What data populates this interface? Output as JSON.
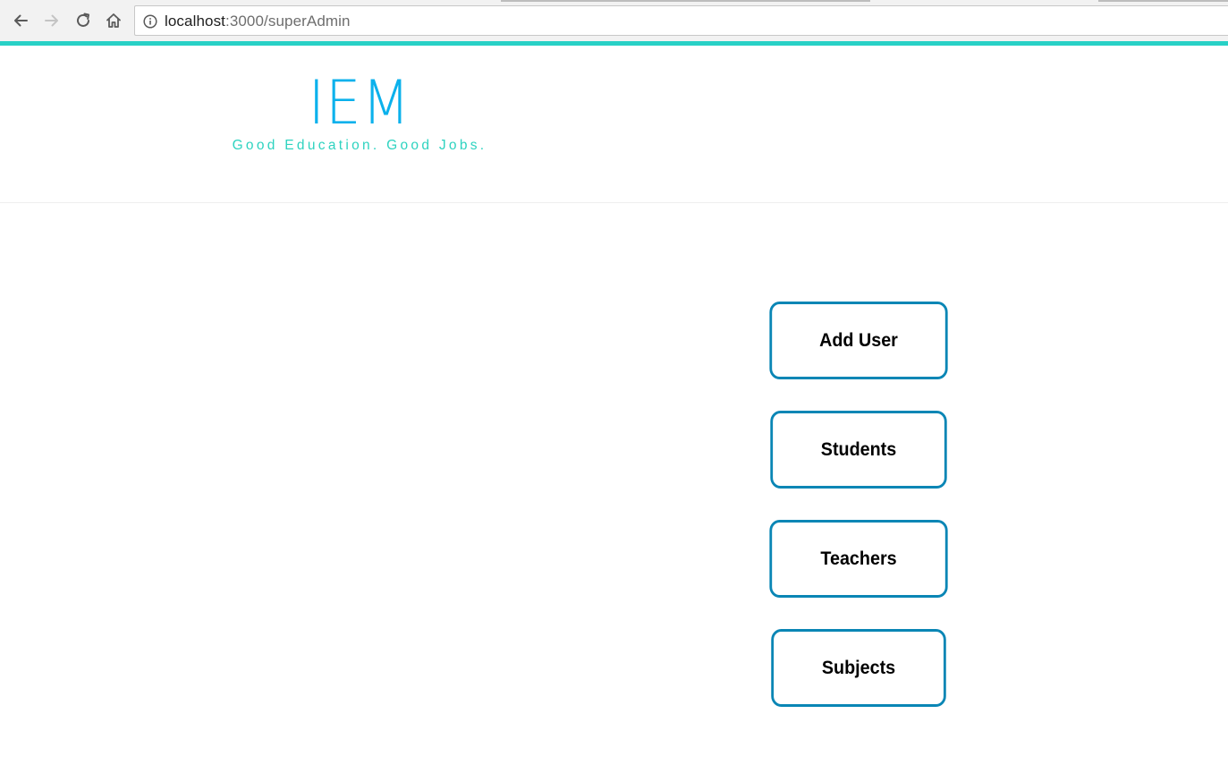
{
  "browser": {
    "url_host": "localhost",
    "url_rest": ":3000/superAdmin",
    "icons": {
      "back": "back-arrow-icon",
      "forward": "forward-arrow-icon",
      "reload": "reload-icon",
      "home": "home-icon",
      "info": "info-icon"
    }
  },
  "header": {
    "title": "IEM",
    "tagline": "Good Education. Good Jobs."
  },
  "actions": {
    "add_user": "Add User",
    "students": "Students",
    "teachers": "Teachers",
    "subjects": "Subjects"
  },
  "colors": {
    "accent_teal": "#28d1c6",
    "brand_blue": "#0bb1ec",
    "tagline_teal": "#2ed3c0",
    "button_border": "#0a86b5"
  }
}
